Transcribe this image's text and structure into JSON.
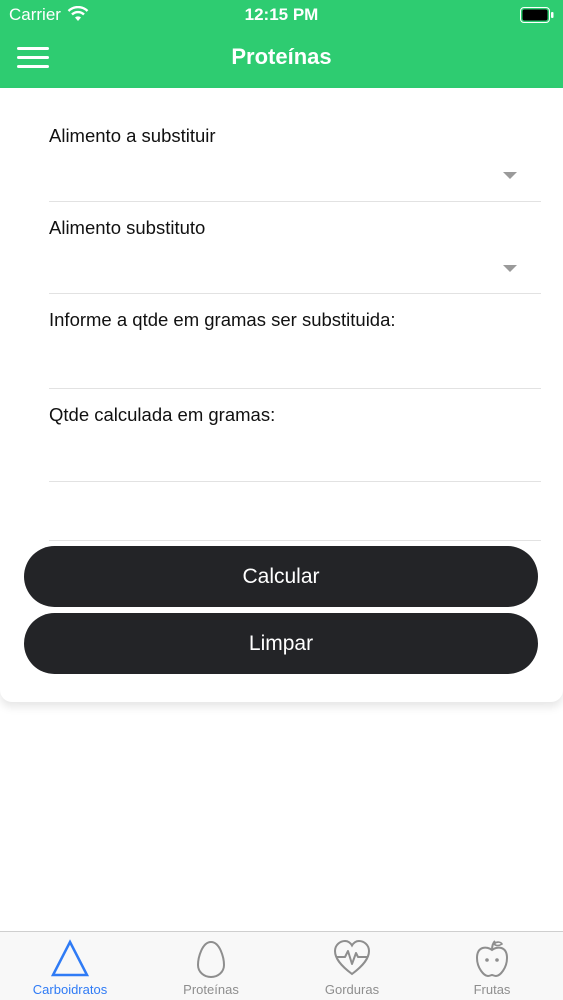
{
  "status_bar": {
    "carrier": "Carrier",
    "time": "12:15 PM"
  },
  "header": {
    "title": "Proteínas",
    "menu_icon": "hamburger-menu-icon",
    "color": "#2ecc71"
  },
  "form": {
    "field_food_to_replace": {
      "label": "Alimento a substituir",
      "value": ""
    },
    "field_replacement_food": {
      "label": "Alimento substituto",
      "value": ""
    },
    "field_grams_input": {
      "label": "Informe a qtde em gramas ser substituida:",
      "value": ""
    },
    "field_grams_result": {
      "label": "Qtde calculada em gramas:",
      "value": ""
    },
    "calculate_label": "Calcular",
    "clear_label": "Limpar",
    "button_color": "#232427"
  },
  "tabs": [
    {
      "label": "Carboidratos",
      "icon": "triangle-icon",
      "active": true
    },
    {
      "label": "Proteínas",
      "icon": "egg-icon",
      "active": false
    },
    {
      "label": "Gorduras",
      "icon": "heart-pulse-icon",
      "active": false
    },
    {
      "label": "Frutas",
      "icon": "apple-icon",
      "active": false
    }
  ],
  "colors": {
    "active_tab": "#2f7bf5",
    "inactive_tab": "#8e8e8e"
  }
}
